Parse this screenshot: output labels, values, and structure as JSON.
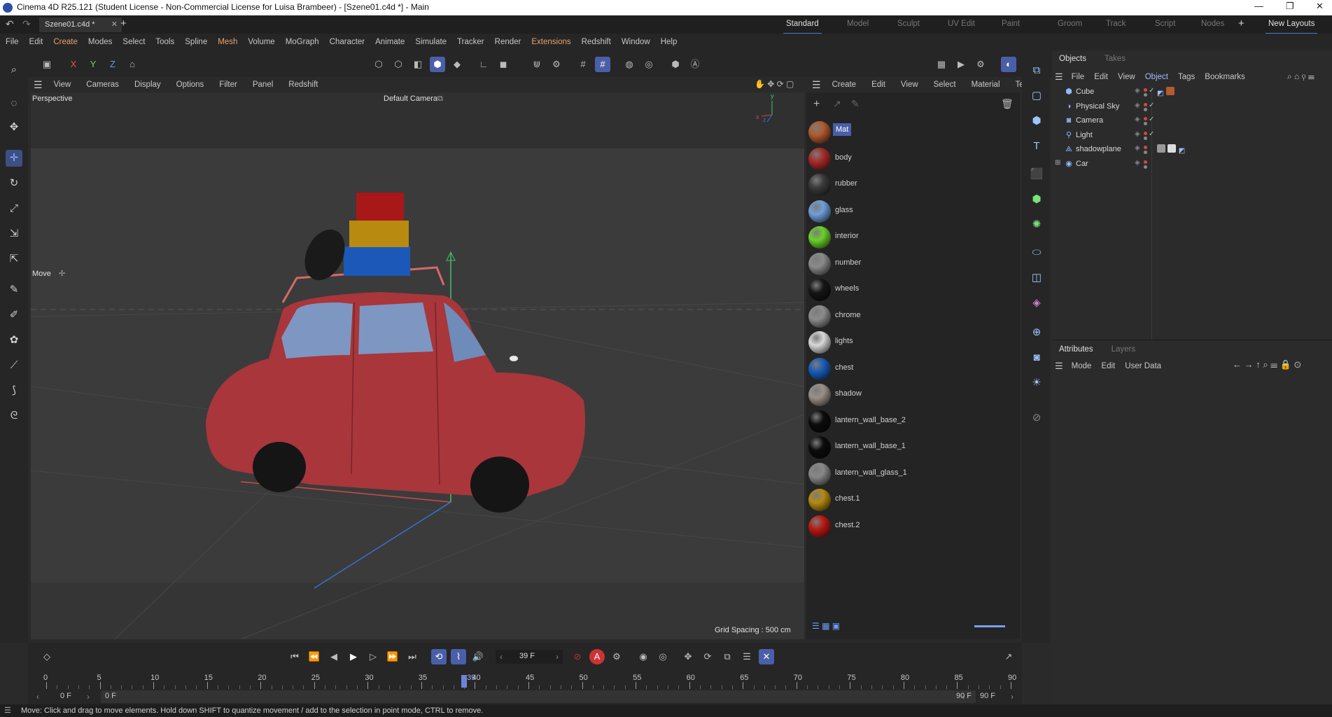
{
  "titlebar": {
    "text": "Cinema 4D R25.121 (Student License - Non-Commercial License for Luisa Brambeer) - [Szene01.c4d *] - Main"
  },
  "tabbar": {
    "doc_tab": "Szene01.c4d *",
    "layouts": [
      "Standard",
      "Model",
      "Sculpt",
      "UV Edit",
      "Paint",
      "Groom",
      "Track",
      "Script",
      "Nodes"
    ],
    "active_layout": "Standard",
    "new_layouts": "New Layouts"
  },
  "menubar": {
    "items": [
      "File",
      "Edit",
      "Create",
      "Modes",
      "Select",
      "Tools",
      "Spline",
      "Mesh",
      "Volume",
      "MoGraph",
      "Character",
      "Animate",
      "Simulate",
      "Tracker",
      "Render",
      "Extensions",
      "Redshift",
      "Window",
      "Help"
    ],
    "highlight": [
      "Create",
      "Mesh",
      "Extensions"
    ],
    "accent": "#e8a26b"
  },
  "toolbar": {
    "axis": [
      "X",
      "Y",
      "Z"
    ]
  },
  "viewport": {
    "menu": [
      "View",
      "Cameras",
      "Display",
      "Options",
      "Filter",
      "Panel",
      "Redshift"
    ],
    "label": "Perspective",
    "camera": "Default Camera",
    "tool": "Move",
    "grid_spacing": "Grid Spacing : 500 cm",
    "axis_labels": [
      "y",
      "x",
      "z"
    ]
  },
  "materials": {
    "menu": [
      "Create",
      "Edit",
      "View",
      "Select",
      "Material",
      "Texture"
    ],
    "items": [
      {
        "name": "Mat",
        "color": "#b35a2e"
      },
      {
        "name": "body",
        "color": "#a82a2a"
      },
      {
        "name": "rubber",
        "color": "#3a3a3a"
      },
      {
        "name": "glass",
        "color": "#6f9fd8"
      },
      {
        "name": "interior",
        "color": "#6bd12a"
      },
      {
        "name": "number",
        "color": "#8a8a8a"
      },
      {
        "name": "wheels",
        "color": "#151515"
      },
      {
        "name": "chrome",
        "color": "#8c8c8c"
      },
      {
        "name": "lights",
        "color": "#d8d8d8"
      },
      {
        "name": "chest",
        "color": "#1a5cb8"
      },
      {
        "name": "shadow",
        "color": "#9a9088"
      },
      {
        "name": "lantern_wall_base_2",
        "color": "#0c0c0c"
      },
      {
        "name": "lantern_wall_base_1",
        "color": "#0c0c0c"
      },
      {
        "name": "lantern_wall_glass_1",
        "color": "#888888"
      },
      {
        "name": "chest.1",
        "color": "#b58a10"
      },
      {
        "name": "chest.2",
        "color": "#b81a12"
      }
    ]
  },
  "objects": {
    "tabs": [
      "Objects",
      "Takes"
    ],
    "menu": [
      "File",
      "Edit",
      "View",
      "Object",
      "Tags",
      "Bookmarks"
    ],
    "active_menu": "Object",
    "items": [
      "Cube",
      "Physical Sky",
      "Camera",
      "Light",
      "shadowplane",
      "Car"
    ]
  },
  "attributes": {
    "tabs": [
      "Attributes",
      "Layers"
    ],
    "menu": [
      "Mode",
      "Edit",
      "User Data"
    ]
  },
  "timeline": {
    "current_frame": "39 F",
    "ticks": [
      "0",
      "5",
      "10",
      "15",
      "20",
      "25",
      "30",
      "35",
      "40",
      "45",
      "50",
      "55",
      "60",
      "65",
      "70",
      "75",
      "80",
      "85",
      "90"
    ],
    "playhead_label": "39",
    "range_start": "0 F",
    "range_start2": "0 F",
    "range_end": "90 F",
    "range_end2": "90 F"
  },
  "status": {
    "text": "Move: Click and drag to move elements. Hold down SHIFT to quantize movement / add to the selection in point mode, CTRL to remove."
  }
}
